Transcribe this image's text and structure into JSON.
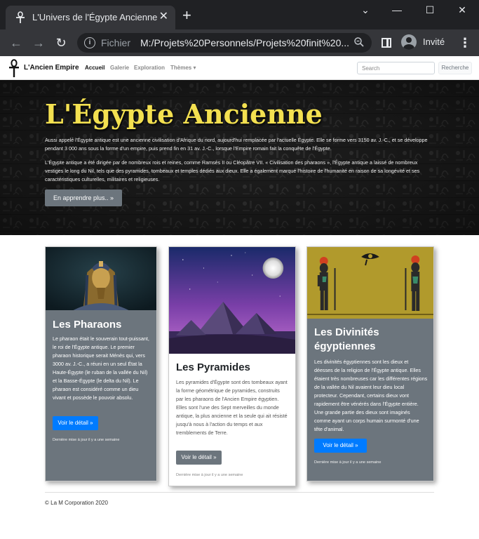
{
  "browser": {
    "tab_title": "L'Univers de l'Égypte Ancienne",
    "scheme": "Fichier",
    "url": "M:/Projets%20Personnels/Projets%20finit%20...",
    "profile_name": "Invité"
  },
  "navbar": {
    "brand": "L'Ancien Empire",
    "links": [
      "Accueil",
      "Galerie",
      "Exploration",
      "Thèmes ▾"
    ],
    "search_placeholder": "Search",
    "search_button": "Recherche"
  },
  "hero": {
    "title": "L'Égypte Ancienne",
    "p1": "Aussi appelé l'Égypte antique est une ancienne civilisation d'Afrique du nord, aujourd'hui remplacée par l'actuelle Égypte. Elle se forme vers 3150 av. J.-C., et se développe pendant 3 000 ans sous la forme d'un empire, puis prend fin en 31 av. J.-C., lorsque l'Empire romain fait la conquête de l'Égypte.",
    "p2": "L'Égypte antique a été dirigée par de nombreux rois et reines, comme Ramsès II ou Cléopâtre VII. « Civilisation des pharaons », l'Égypte antique a laissé de nombreux vestiges le long du Nil, tels que des pyramides, tombeaux et temples dédiés aux dieux. Elle a également marqué l'histoire de l'humanité en raison de sa longévité et ses caractéristiques culturelles, militaires et religieuses.",
    "button": "En apprendre plus.. »"
  },
  "cards": [
    {
      "title": "Les Pharaons",
      "text": "Le pharaon était le souverain tout-puissant, le roi de l'Égypte antique. Le premier pharaon historique serait Ménès qui, vers 3000 av. J.-C., a réuni en un seul État la Haute-Égypte (le ruban de la vallée du Nil) et la Basse-Égypte (le delta du Nil). Le pharaon est considéré comme un dieu vivant et possède le pouvoir absolu.",
      "button": "Voir le détail »",
      "footer": "Dernière mise à jour il y a une semaine"
    },
    {
      "title": "Les Pyramides",
      "text": "Les pyramides d'Égypte sont des tombeaux ayant la forme géométrique de pyramides, construits par les pharaons de l'Ancien Empire égyptien. Elles sont l'une des Sept merveilles du monde antique, la plus ancienne et la seule qui ait résisté jusqu'à nous à l'action du temps et aux tremblements de Terre.",
      "button": "Voir le détail »",
      "footer": "Dernière mise à jour il y a une semaine"
    },
    {
      "title": "Les Divinités égyptiennes",
      "text": "Les divinités égyptiennes sont les dieux et déesses de la religion de l'Égypte antique. Elles étaient très nombreuses car les différentes régions de la vallée du Nil avaient leur dieu local protecteur. Cependant, certains dieux vont rapidement être vénérés dans l'Égypte entière. Une grande partie des dieux sont imaginés comme ayant un corps humain surmonté d'une tête d'animal.",
      "button": "Voir le détail »",
      "footer": "Dernière mise à jour il y a une semaine"
    }
  ],
  "footer": "© La M Corporation 2020",
  "colors": {
    "hero_title": "#f3e050",
    "primary": "#007bff",
    "secondary": "#6c757d"
  }
}
